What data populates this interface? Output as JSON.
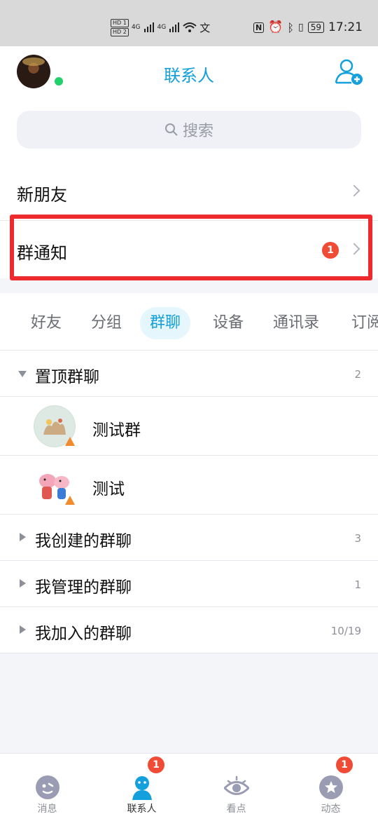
{
  "status_bar": {
    "hd1": "HD 1",
    "hd2": "HD 2",
    "sig1": "4G",
    "sig2": "4G",
    "battery": "59",
    "time": "17:21"
  },
  "header": {
    "title": "联系人"
  },
  "search": {
    "placeholder": "搜索"
  },
  "rows": {
    "new_friends": "新朋友",
    "group_notice": "群通知",
    "group_notice_badge": "1"
  },
  "tabs": [
    "好友",
    "分组",
    "群聊",
    "设备",
    "通讯录",
    "订阅"
  ],
  "active_tab": "群聊",
  "groups": {
    "pinned": {
      "label": "置顶群聊",
      "count": "2"
    },
    "chats": [
      {
        "name": "测试群",
        "avatar": "deer-illustration-avatar"
      },
      {
        "name": "测试",
        "avatar": "peppa-pig-avatar"
      }
    ],
    "created": {
      "label": "我创建的群聊",
      "count": "3"
    },
    "managed": {
      "label": "我管理的群聊",
      "count": "1"
    },
    "joined": {
      "label": "我加入的群聊",
      "count": "10/19"
    }
  },
  "bottom_nav": {
    "items": [
      {
        "label": "消息",
        "icon": "chat-face-icon"
      },
      {
        "label": "联系人",
        "icon": "person-icon",
        "badge": "1"
      },
      {
        "label": "看点",
        "icon": "eye-icon"
      },
      {
        "label": "动态",
        "icon": "star-icon",
        "badge": "1"
      }
    ]
  },
  "colors": {
    "accent": "#13a0dc",
    "badge": "#f04b34",
    "highlight_frame": "#ef2a2f",
    "online": "#22d16a"
  }
}
